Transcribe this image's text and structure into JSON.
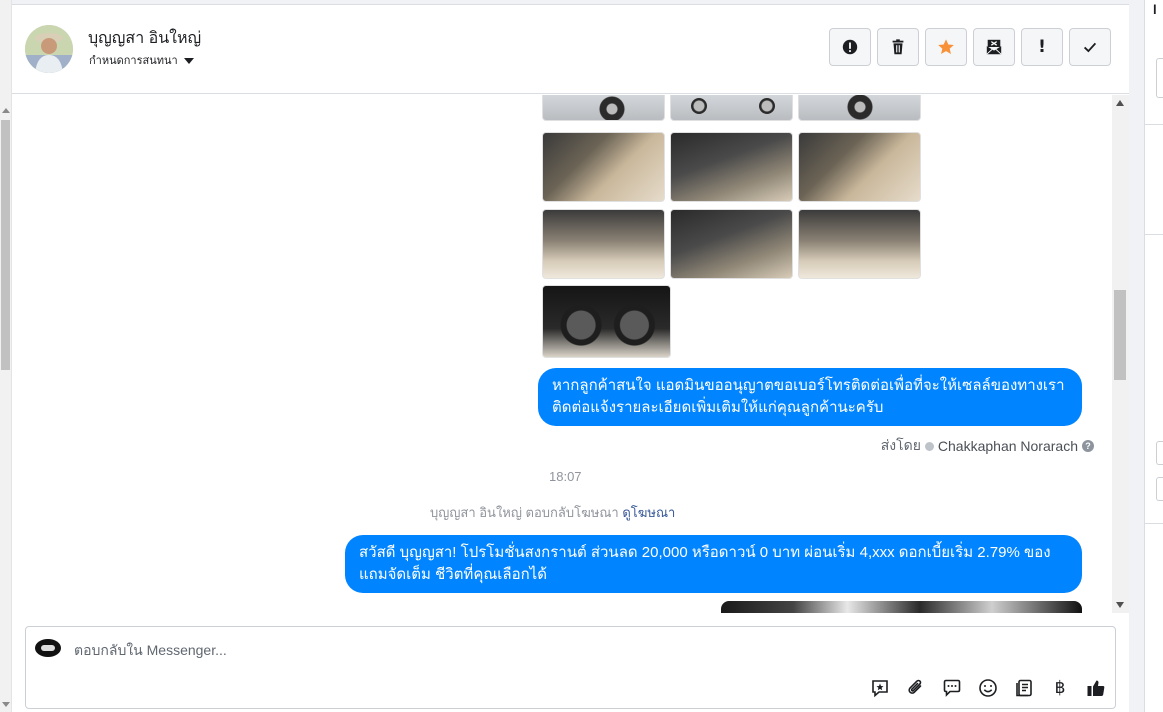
{
  "header": {
    "contact_name": "บุญญสา อินใหญ่",
    "assign_label": "กำหนดการสนทนา",
    "actions": [
      "spam",
      "delete",
      "star",
      "mark-unread",
      "important",
      "done"
    ]
  },
  "thread": {
    "message_1": "หากลูกค้าสนใจ แอดมินขออนุญาตขอเบอร์โทรติดต่อเพื่อที่จะให้เซลล์ของทางเรา ติดต่อแจ้งรายละเอียดเพิ่มเติมให้แก่คุณลูกค้านะครับ",
    "sent_by_prefix": "ส่งโดย",
    "sent_by_agent": "Chakkaphan Norarach",
    "help_mark": "?",
    "timestamp": "18:07",
    "ad_reply_notice": "บุญญสา อินใหญ่ ตอบกลับโฆษณา",
    "ad_link": "ดูโฆษณา",
    "message_2": "สวัสดี บุญญสา! โปรโมชั่นสงกรานต์ ส่วนลด 20,000 หรือดาวน์ 0 บาท ผ่อนเริ่ม 4,xxx ดอกเบี้ยเริ่ม 2.79% ของแถมจัดเต็ม ชีวิตที่คุณเลือกได้",
    "message_2_line1": "สวัสดี บุญญสา! โปรโมชั่นสงกรานต์ ส่วนลด 20,000 หรือดาวน์ 0 บาท ผ่อนเริ่ม 4,xxx ดอกเบี้ยเริ่ม 2.79% ของ",
    "message_2_line2": "แถมจัดเต็ม ชีวิตที่คุณเลือกได้",
    "message_1_line1": "หากลูกค้าสนใจ แอดมินขออนุญาตขอเบอร์โทรติดต่อเพื่อที่จะให้เซลล์ของทางเรา",
    "message_1_line2": "ติดต่อแจ้งรายละเอียดเพิ่มเติมให้แก่คุณลูกค้านะครับ"
  },
  "composer": {
    "placeholder": "ตอบกลับใน Messenger...",
    "baht_symbol": "฿",
    "tools": [
      "saved-reply-icon",
      "attach-icon",
      "chat-bubble-icon",
      "emoji-icon",
      "notes-icon",
      "payment-icon",
      "like-icon"
    ]
  },
  "colors": {
    "accent": "#0084ff",
    "star": "#f7923b"
  }
}
